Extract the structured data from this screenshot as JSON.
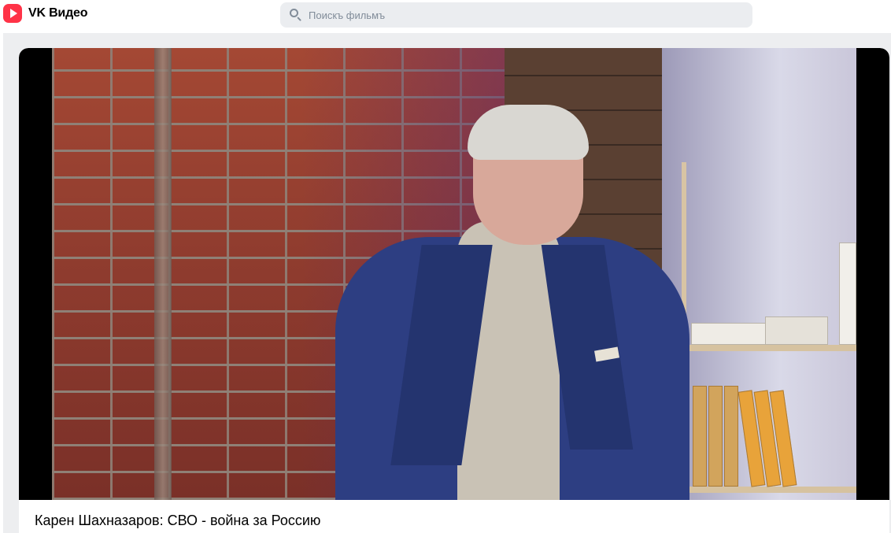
{
  "app": {
    "name": "VK Видео",
    "logo_icon": "vk-video-play-icon",
    "brand_color": "#ff3347"
  },
  "search": {
    "placeholder": "Поискъ фильмъ",
    "value": ""
  },
  "video": {
    "title": "Карен Шахназаров: СВО - война за Россию"
  }
}
